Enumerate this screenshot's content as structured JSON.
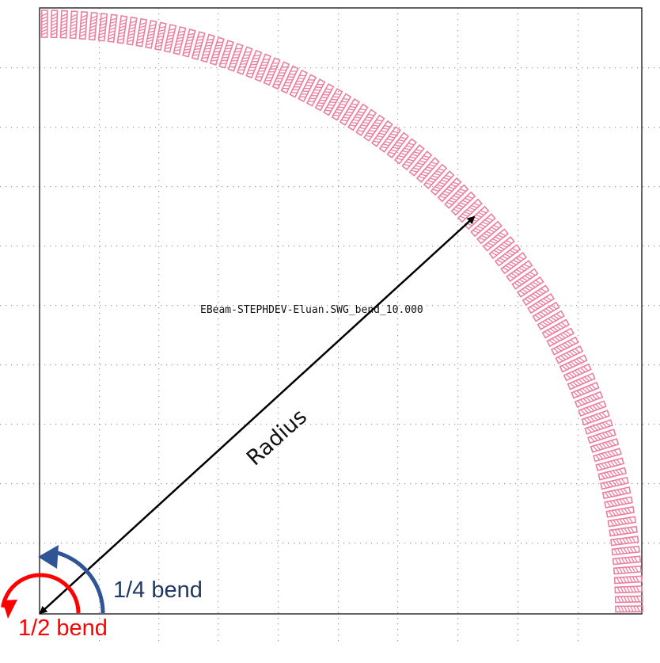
{
  "layout_view": {
    "cell_name": "EBeam-STEPHDEV-Eluan.SWG_bend_10.000",
    "grid_visible": true
  },
  "annotations": {
    "radius_label": "Radius",
    "quarter_bend_label": "1/4 bend",
    "half_bend_label": "1/2 bend"
  },
  "colors": {
    "background": "#ffffff",
    "grid_dot": "#9a9a9a",
    "cell_frame": "#111111",
    "swg_segment": "#ea7fa0",
    "radius_arrow": "#000000",
    "quarter_bend": "#2f5597",
    "quarter_bend_text": "#1f3864",
    "half_bend": "#ff0000"
  },
  "swg_bend": {
    "segment_count": 95,
    "sweep_degrees": 90
  }
}
